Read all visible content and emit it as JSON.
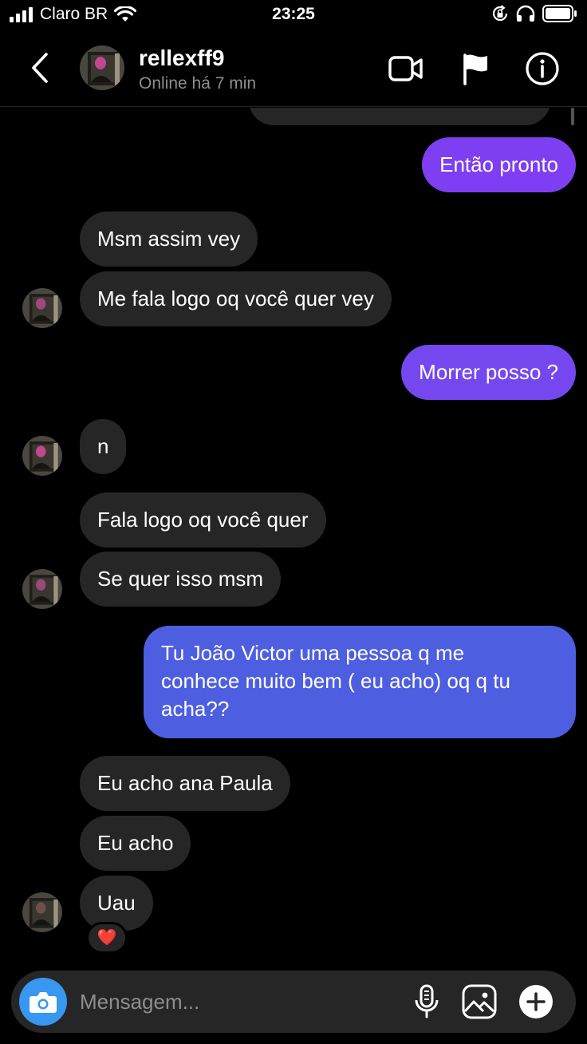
{
  "status_bar": {
    "carrier": "Claro BR",
    "time": "23:25",
    "icons": [
      "signal-icon",
      "wifi-icon",
      "orientation-lock-icon",
      "headphones-icon",
      "battery-icon"
    ]
  },
  "header": {
    "username": "rellexff9",
    "status": "Online há 7 min",
    "icons": [
      "back-icon",
      "video-call-icon",
      "flag-icon",
      "info-icon"
    ]
  },
  "messages": [
    {
      "id": "m1",
      "from": "me",
      "text": "Então pronto"
    },
    {
      "id": "m2",
      "from": "them",
      "text": "Msm assim vey"
    },
    {
      "id": "m3",
      "from": "them",
      "text": "Me fala logo oq você quer vey"
    },
    {
      "id": "m4",
      "from": "me",
      "text": "Morrer posso ?"
    },
    {
      "id": "m5",
      "from": "them",
      "text": "n"
    },
    {
      "id": "m6",
      "from": "them",
      "text": "Fala logo oq você quer"
    },
    {
      "id": "m7",
      "from": "them",
      "text": "Se quer isso msm"
    },
    {
      "id": "m8",
      "from": "me",
      "lines": [
        "Tu João Victor uma pessoa q me",
        "conhece muito bem ( eu acho) oq q tu",
        "acha??"
      ]
    },
    {
      "id": "m9",
      "from": "them",
      "text": "Eu acho ana Paula"
    },
    {
      "id": "m10",
      "from": "them",
      "text": "Eu acho"
    },
    {
      "id": "m11",
      "from": "them",
      "text": "Uau",
      "reaction": "❤️"
    }
  ],
  "composer": {
    "placeholder": "Mensagem...",
    "icons": [
      "camera-icon",
      "microphone-icon",
      "gallery-icon",
      "plus-icon"
    ]
  },
  "colors": {
    "background": "#000000",
    "incoming_bubble": "#262626",
    "outgoing_purple": "#7e3ff2",
    "outgoing_blue": "#4d5ee0",
    "camera_button": "#3897f0",
    "subtitle": "#8e8e8e"
  }
}
